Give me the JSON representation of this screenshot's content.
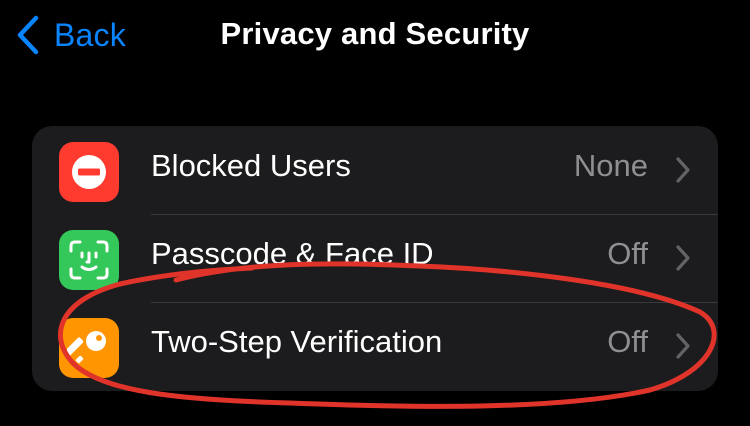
{
  "nav": {
    "back_label": "Back",
    "title": "Privacy and Security",
    "accent_color": "#0a84ff"
  },
  "rows": [
    {
      "label": "Blocked Users",
      "value": "None",
      "icon": "blocked-icon",
      "icon_color": "#ff3b30"
    },
    {
      "label": "Passcode & Face ID",
      "value": "Off",
      "icon": "face-id-icon",
      "icon_color": "#34c759"
    },
    {
      "label": "Two-Step Verification",
      "value": "Off",
      "icon": "key-icon",
      "icon_color": "#ff9500"
    }
  ],
  "annotation": {
    "color": "#e0342a",
    "target": "Two-Step Verification"
  }
}
